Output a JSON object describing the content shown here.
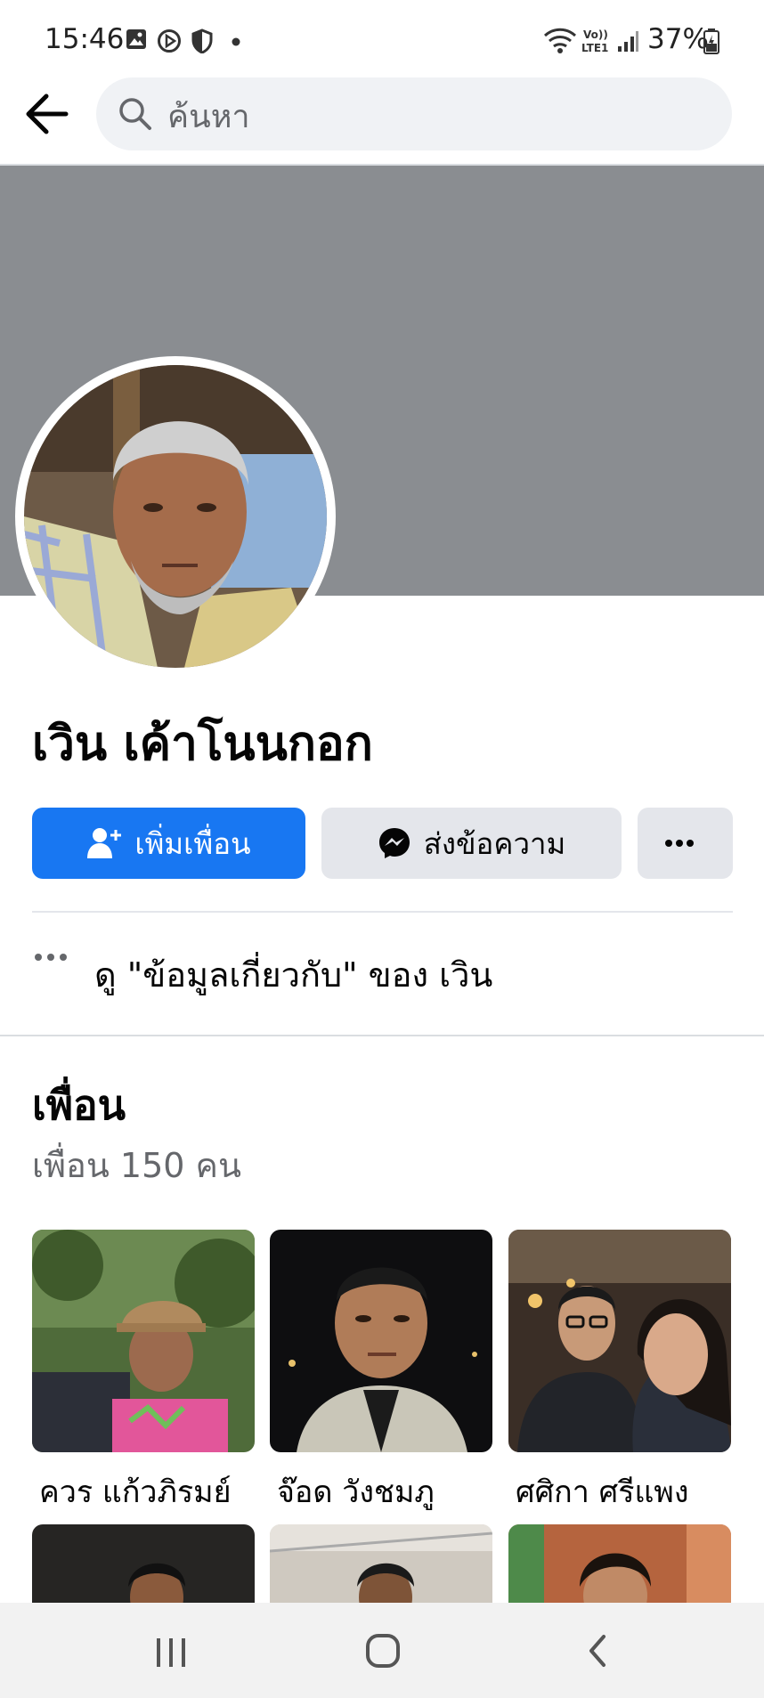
{
  "status_bar": {
    "time": "15:46",
    "battery": "37%",
    "icons": [
      "gallery-icon",
      "circle-play-icon",
      "shield-icon",
      "dot-icon",
      "wifi-icon",
      "volte-icon",
      "signal-icon",
      "battery-icon"
    ]
  },
  "search": {
    "placeholder": "ค้นหา"
  },
  "profile": {
    "name": "เวิน เค้าโนนกอก"
  },
  "actions": {
    "add_friend": "เพิ่มเพื่อน",
    "message": "ส่งข้อความ",
    "more": "···"
  },
  "about": {
    "text": "ดู \"ข้อมูลเกี่ยวกับ\" ของ เวิน"
  },
  "friends": {
    "title": "เพื่อน",
    "count": "เพื่อน 150 คน",
    "items": [
      {
        "name": "ควร แก้วภิรมย์"
      },
      {
        "name": "จ๊อด วังชมภู"
      },
      {
        "name": "ศศิกา ศรีแพง"
      }
    ]
  },
  "colors": {
    "brand_blue": "#1877f2",
    "cover_gray": "#8a8d91",
    "button_gray": "#e4e6eb"
  }
}
